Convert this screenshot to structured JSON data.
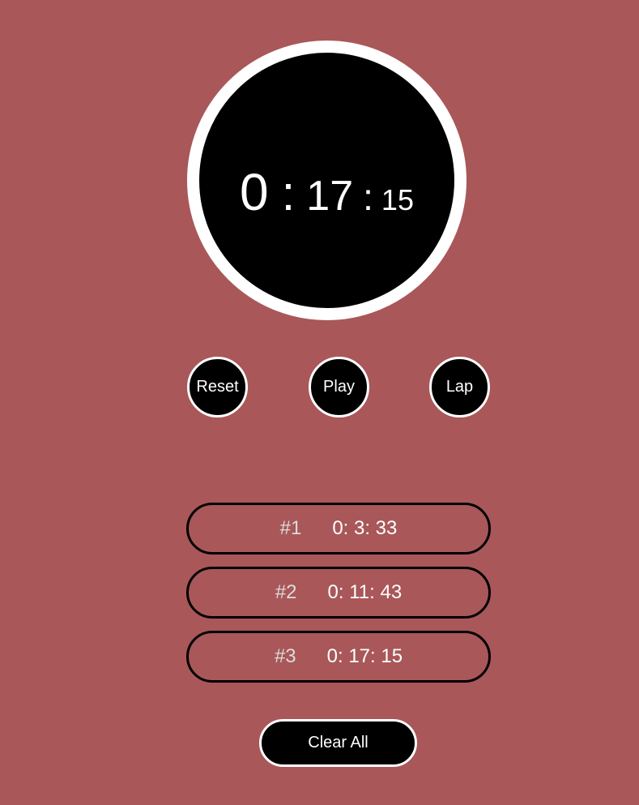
{
  "colors": {
    "background": "#a95759",
    "dial_fill": "#000000",
    "dial_ring": "#ffffff",
    "lap_border": "#000000",
    "lap_number": "#dcdcdc",
    "text": "#ffffff"
  },
  "display": {
    "hours": "0",
    "separator_1": ":",
    "minutes": "17",
    "separator_2": ":",
    "seconds": "15"
  },
  "controls": {
    "reset_label": "Reset",
    "play_label": "Play",
    "lap_label": "Lap"
  },
  "laps": [
    {
      "number": "#1",
      "time": "0: 3: 33"
    },
    {
      "number": "#2",
      "time": "0: 11: 43"
    },
    {
      "number": "#3",
      "time": "0: 17: 15"
    }
  ],
  "clear_all_label": "Clear All"
}
